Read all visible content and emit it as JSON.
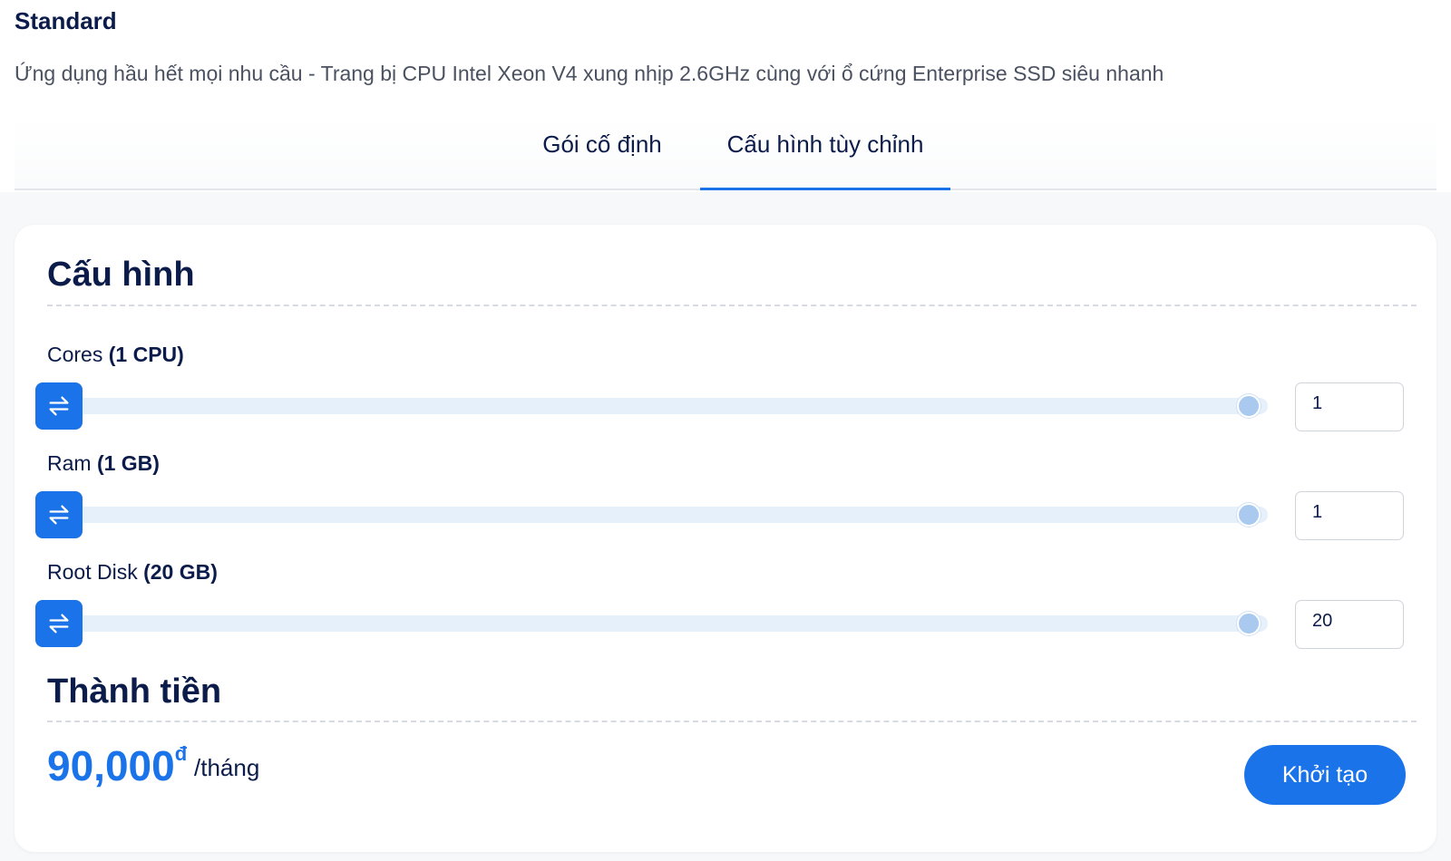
{
  "plan": {
    "title": "Standard",
    "description": "Ứng dụng hầu hết mọi nhu cầu - Trang bị CPU Intel Xeon V4 xung nhịp 2.6GHz cùng với ổ cứng Enterprise SSD siêu nhanh"
  },
  "tabs": [
    {
      "label": "Gói cố định",
      "active": false
    },
    {
      "label": "Cấu hình tùy chỉnh",
      "active": true
    }
  ],
  "config": {
    "title": "Cấu hình",
    "rows": [
      {
        "label": "Cores",
        "value_text": "(1 CPU)",
        "input_value": "1",
        "slider_position": 0
      },
      {
        "label": "Ram",
        "value_text": "(1 GB)",
        "input_value": "1",
        "slider_position": 0
      },
      {
        "label": "Root Disk",
        "value_text": "(20 GB)",
        "input_value": "20",
        "slider_position": 0
      }
    ],
    "slider_icon": "swap-arrows-icon"
  },
  "total": {
    "title": "Thành tiền",
    "amount": "90,000",
    "currency": "đ",
    "period": "/tháng",
    "create_label": "Khởi tạo"
  },
  "colors": {
    "accent": "#1a73e8",
    "heading": "#0b1b4a",
    "track": "#e6f0fb"
  }
}
